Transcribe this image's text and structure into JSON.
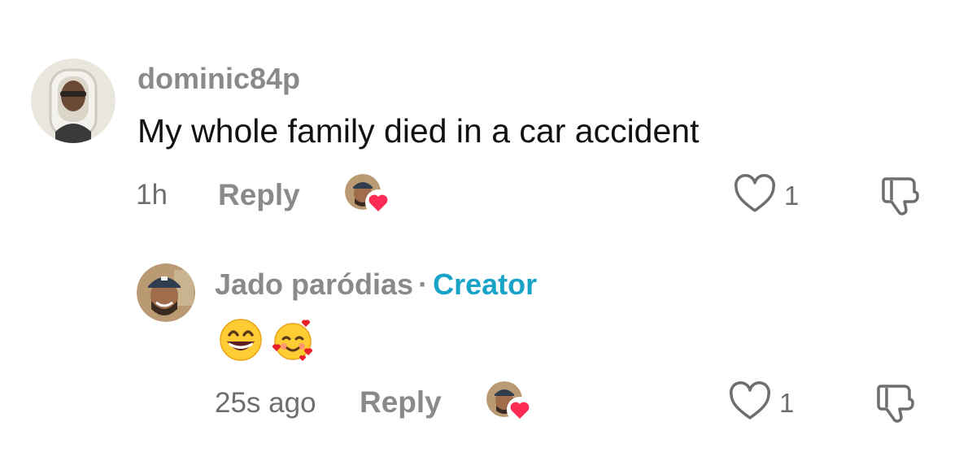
{
  "comments": [
    {
      "username": "dominic84p",
      "text": "My whole family died in a car accident",
      "time": "1h",
      "reply_label": "Reply",
      "like_count": "1",
      "avatar_icon": "user-avatar",
      "liked_by_creator": true
    },
    {
      "username": "Jado paródias",
      "separator": "·",
      "badge": "Creator",
      "emojis": [
        "grinning-face-emoji",
        "smiling-face-with-hearts-emoji"
      ],
      "time": "25s ago",
      "reply_label": "Reply",
      "like_count": "1",
      "avatar_icon": "creator-avatar",
      "liked_by_creator": true
    }
  ],
  "colors": {
    "username": "#8a8a8a",
    "creator_badge": "#1aa3c9",
    "heart_badge": "#fe2c55",
    "icon_stroke": "#6e6e6e"
  }
}
